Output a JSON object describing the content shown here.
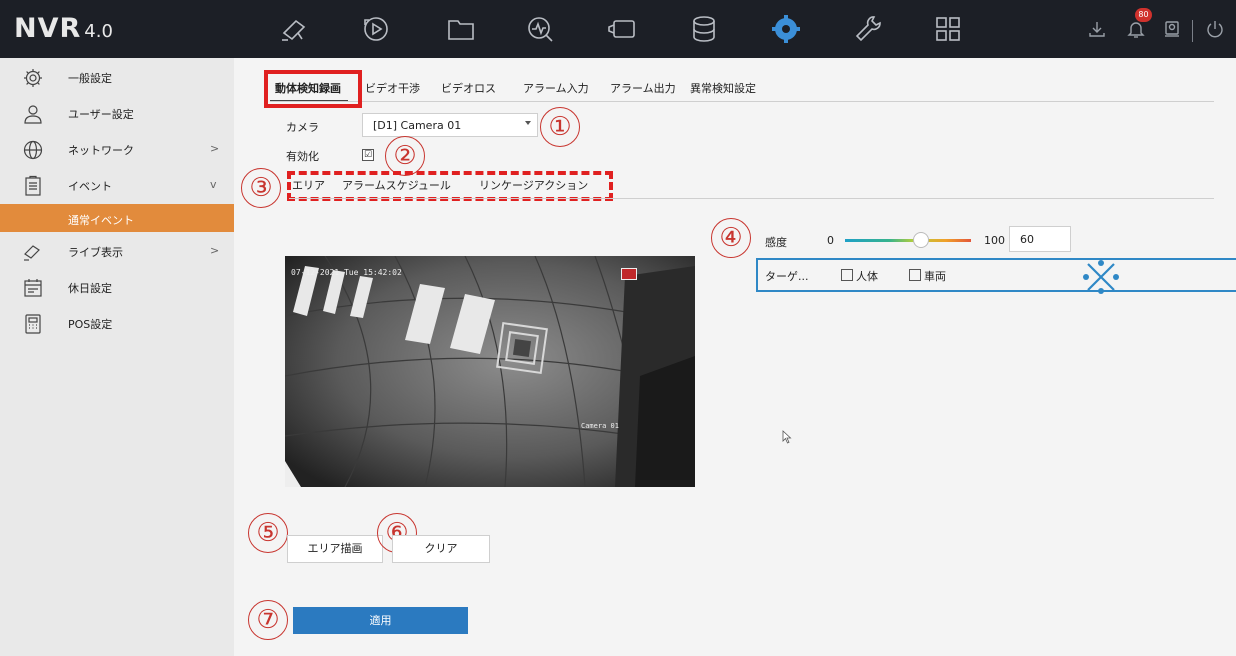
{
  "header": {
    "logo": "NVR",
    "version": "4.0",
    "nav_icons": [
      "live-view-icon",
      "playback-icon",
      "file-icon",
      "search-analysis-icon",
      "camera-icon",
      "storage-icon",
      "settings-gear-icon",
      "maintenance-wrench-icon",
      "apps-grid-icon"
    ],
    "active_nav": "settings-gear-icon",
    "notification_count": "80",
    "right_icons": [
      "download-icon",
      "notification-bell-icon",
      "account-icon",
      "power-icon"
    ]
  },
  "sidebar": {
    "items": [
      {
        "label": "一般設定",
        "icon": "gear-icon"
      },
      {
        "label": "ユーザー設定",
        "icon": "user-icon"
      },
      {
        "label": "ネットワーク",
        "icon": "globe-icon",
        "chevron": ">"
      },
      {
        "label": "イベント",
        "icon": "clipboard-icon",
        "chevron": "v"
      },
      {
        "label": "ライブ表示",
        "icon": "camera-icon",
        "chevron": ">"
      },
      {
        "label": "休日設定",
        "icon": "calendar-icon"
      },
      {
        "label": "POS設定",
        "icon": "pos-terminal-icon"
      }
    ],
    "sub_item": "通常イベント"
  },
  "tabs": {
    "items": [
      "動体検知録画",
      "ビデオ干渉",
      "ビデオロス",
      "アラーム入力",
      "アラーム出力",
      "異常検知設定"
    ],
    "active": "動体検知録画"
  },
  "form": {
    "camera_label": "カメラ",
    "camera_value": "[D1] Camera 01",
    "enable_label": "有効化",
    "enable_checked": true,
    "enable_mark": "☑"
  },
  "subtabs": [
    "エリア",
    "アラームスケジュール",
    "リンケージアクション"
  ],
  "video": {
    "osd_time": "07-12-2021 Tue 15:42:02",
    "osd_camera": "Camera 01"
  },
  "sensitivity": {
    "label": "感度",
    "min": "0",
    "max": "100",
    "value": "60",
    "level": 0.6
  },
  "target": {
    "label": "ターゲ...",
    "options": [
      "人体",
      "車両"
    ]
  },
  "buttons": {
    "draw_area": "エリア描画",
    "clear": "クリア",
    "apply": "適用"
  },
  "annotations": {
    "circle_1": "①",
    "circle_2": "②",
    "circle_3": "③",
    "circle_4": "④",
    "circle_5": "⑤",
    "circle_6": "⑥",
    "circle_7": "⑦",
    "accent_red": "#e02020",
    "accent_blue": "#2f88c6"
  }
}
